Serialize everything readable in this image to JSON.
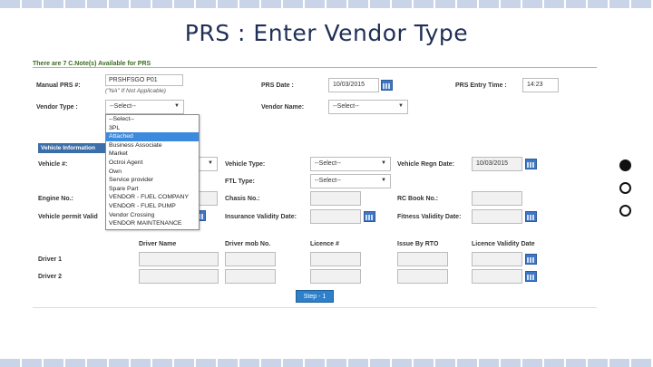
{
  "slide": {
    "title": "PRS : Enter Vendor Type"
  },
  "form": {
    "notice": "There are 7 C.Note(s) Available for PRS",
    "manual_prs_label": "Manual PRS #:",
    "manual_prs_value": "PRSHFSGO P01",
    "manual_prs_hint": "(\"NA\" If Not Applicable)",
    "prs_date_label": "PRS Date :",
    "prs_date_value": "10/03/2015",
    "prs_entry_time_label": "PRS Entry Time :",
    "prs_entry_time_value": "14:23",
    "vendor_type_label": "Vendor Type :",
    "vendor_type_value": "--Select--",
    "vendor_name_label": "Vendor Name:",
    "vendor_name_value": "--Select--",
    "vendor_type_options": [
      "--Select--",
      "3PL",
      "Attached",
      "Business Associate",
      "Market",
      "Octroi Agent",
      "Own",
      "Service provider",
      "Spare Part",
      "VENDOR - FUEL COMPANY",
      "VENDOR - FUEL PUMP",
      "Vendor Crossing",
      "VENDOR MAINTENANCE"
    ],
    "vendor_type_highlighted": "Attached",
    "section_vehicle_info": "Vehicle Information",
    "vehicle_label": "Vehicle #:",
    "vehicle_type_label": "Vehicle Type:",
    "vehicle_type_value": "--Select--",
    "vehicle_regn_date_label": "Vehicle Regn Date:",
    "vehicle_regn_date_value": "10/03/2015",
    "ftl_type_label": "FTL Type:",
    "ftl_type_value": "--Select--",
    "engine_no_label": "Engine No.:",
    "chasis_no_label": "Chasis No.:",
    "rc_book_no_label": "RC Book No.:",
    "vehicle_permit_label": "Vehicle permit Valid",
    "insurance_validity_label": "Insurance Validity Date:",
    "fitness_validity_label": "Fitness Validity Date:",
    "driver_headers": [
      "Driver Name",
      "Driver mob No.",
      "Licence #",
      "Issue By RTO",
      "Licence Validity Date"
    ],
    "driver_1_label": "Driver 1",
    "driver_2_label": "Driver 2",
    "step_button": "Step - 1"
  },
  "pager": {
    "dots": 3,
    "active_index": 0
  }
}
